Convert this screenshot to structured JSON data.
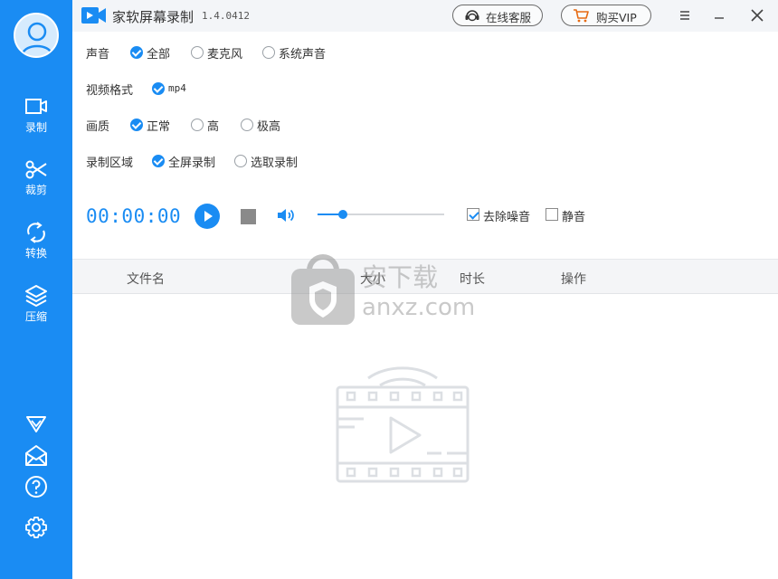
{
  "app": {
    "title": "家软屏幕录制",
    "version": "1.4.0412"
  },
  "header": {
    "support_label": "在线客服",
    "vip_label": "购买VIP"
  },
  "sidebar": {
    "items": [
      {
        "label": "录制",
        "icon": "record-camera-icon"
      },
      {
        "label": "裁剪",
        "icon": "scissors-icon"
      },
      {
        "label": "转换",
        "icon": "convert-icon"
      },
      {
        "label": "压缩",
        "icon": "layers-icon"
      }
    ],
    "bottom_icons": [
      "vip-diamond-icon",
      "mail-icon",
      "help-icon",
      "settings-gear-icon"
    ]
  },
  "options": {
    "audio": {
      "label": "声音",
      "choices": [
        "全部",
        "麦克风",
        "系统声音"
      ],
      "selected": "全部"
    },
    "format": {
      "label": "视频格式",
      "choices": [
        "mp4"
      ],
      "selected": "mp4"
    },
    "quality": {
      "label": "画质",
      "choices": [
        "正常",
        "高",
        "极高"
      ],
      "selected": "正常"
    },
    "area": {
      "label": "录制区域",
      "choices": [
        "全屏录制",
        "选取录制"
      ],
      "selected": "全屏录制"
    }
  },
  "controls": {
    "timer": "00:00:00",
    "volume_fraction": 0.2,
    "denoise_label": "去除噪音",
    "denoise_checked": true,
    "mute_label": "静音",
    "mute_checked": false
  },
  "table": {
    "columns": [
      "文件名",
      "大小",
      "时长",
      "操作"
    ]
  },
  "watermark": {
    "text1": "安下载",
    "text2": "anxz.com"
  },
  "colors": {
    "accent": "#1a8cf3",
    "sidebar": "#1a8cf3",
    "titlebar": "#f3f5f8"
  }
}
